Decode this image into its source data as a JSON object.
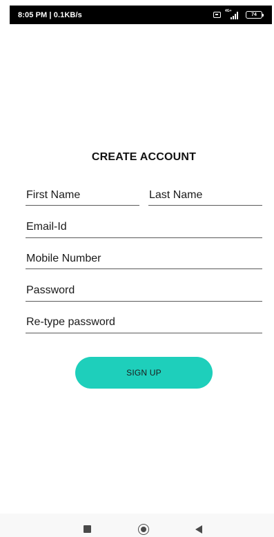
{
  "status_bar": {
    "time_speed": "8:05 PM | 0.1KB/s",
    "signal_label": "4G+",
    "battery_level": "74",
    "icons": [
      "vibrate-icon",
      "signal-icon",
      "battery-icon"
    ]
  },
  "form": {
    "title": "CREATE ACCOUNT",
    "fields": {
      "first_name": "First Name",
      "last_name": "Last Name",
      "email": "Email-Id",
      "mobile": "Mobile Number",
      "password": "Password",
      "retype_password": "Re-type password"
    },
    "signup_label": "SIGN UP"
  },
  "nav_bar": {
    "icons": [
      "recent-apps-icon",
      "home-icon",
      "back-icon"
    ]
  },
  "colors": {
    "accent": "#1ecfbb",
    "underline": "#595959",
    "status_bar_bg": "#000000"
  }
}
